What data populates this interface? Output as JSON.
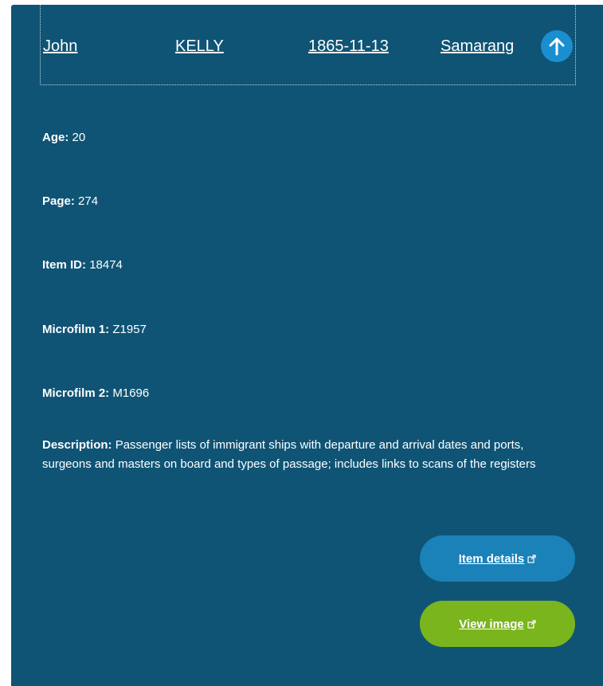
{
  "record": {
    "given_name": "John",
    "surname": "KELLY",
    "date": "1865-11-13",
    "ship": "Samarang"
  },
  "fields": {
    "age": {
      "label": "Age:",
      "value": "20"
    },
    "page": {
      "label": "Page:",
      "value": "274"
    },
    "item_id": {
      "label": "Item ID:",
      "value": "18474"
    },
    "microfilm_1": {
      "label": "Microfilm 1:",
      "value": "Z1957"
    },
    "microfilm_2": {
      "label": "Microfilm 2:",
      "value": "M1696"
    },
    "description": {
      "label": "Description:",
      "value": "Passenger lists of immigrant ships with departure and arrival dates and ports, surgeons and masters on board and types of passage; includes links to scans of the registers"
    }
  },
  "actions": {
    "item_details_label": "Item details",
    "view_image_label": "View image"
  },
  "icons": {
    "scroll_up": "arrow-up-icon",
    "external": "external-link-icon"
  },
  "colors": {
    "card_background": "#0f5475",
    "up_button": "#1a8fd0",
    "item_details_button": "#1a82b8",
    "view_image_button": "#7ab51d",
    "text": "#ffffff"
  }
}
